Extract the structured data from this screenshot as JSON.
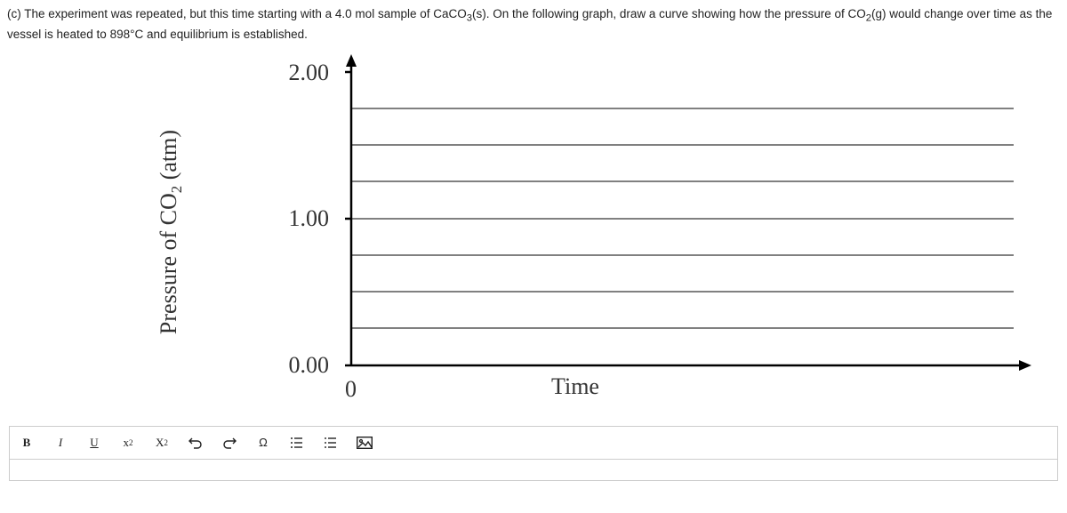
{
  "question": {
    "prefix": "(c) The experiment was repeated, but this time starting with a 4.0 mol sample of CaCO",
    "sub1": "3",
    "mid1": "(s). On the following graph, draw a curve showing how the pressure of CO",
    "sub2": "2",
    "mid2": "(g) would change over time as the vessel is heated to 898°C and equilibrium is established."
  },
  "chart_data": {
    "type": "line",
    "series": [],
    "y_ticks": [
      "2.00",
      "1.00",
      "0.00"
    ],
    "x_ticks": [
      "0"
    ],
    "xlabel": "Time",
    "ylabel_pre": "Pressure of CO",
    "ylabel_sub": "2",
    "ylabel_post": " (atm)",
    "ylim": [
      0,
      2
    ],
    "grid_y_lines": [
      0.25,
      0.5,
      0.75,
      1.0,
      1.25,
      1.5,
      1.75
    ]
  },
  "toolbar": {
    "bold": "B",
    "italic": "I",
    "underline": "U",
    "super_base": "x",
    "super_exp": "2",
    "sub_base": "X",
    "sub_sub": "2",
    "omega": "Ω"
  }
}
